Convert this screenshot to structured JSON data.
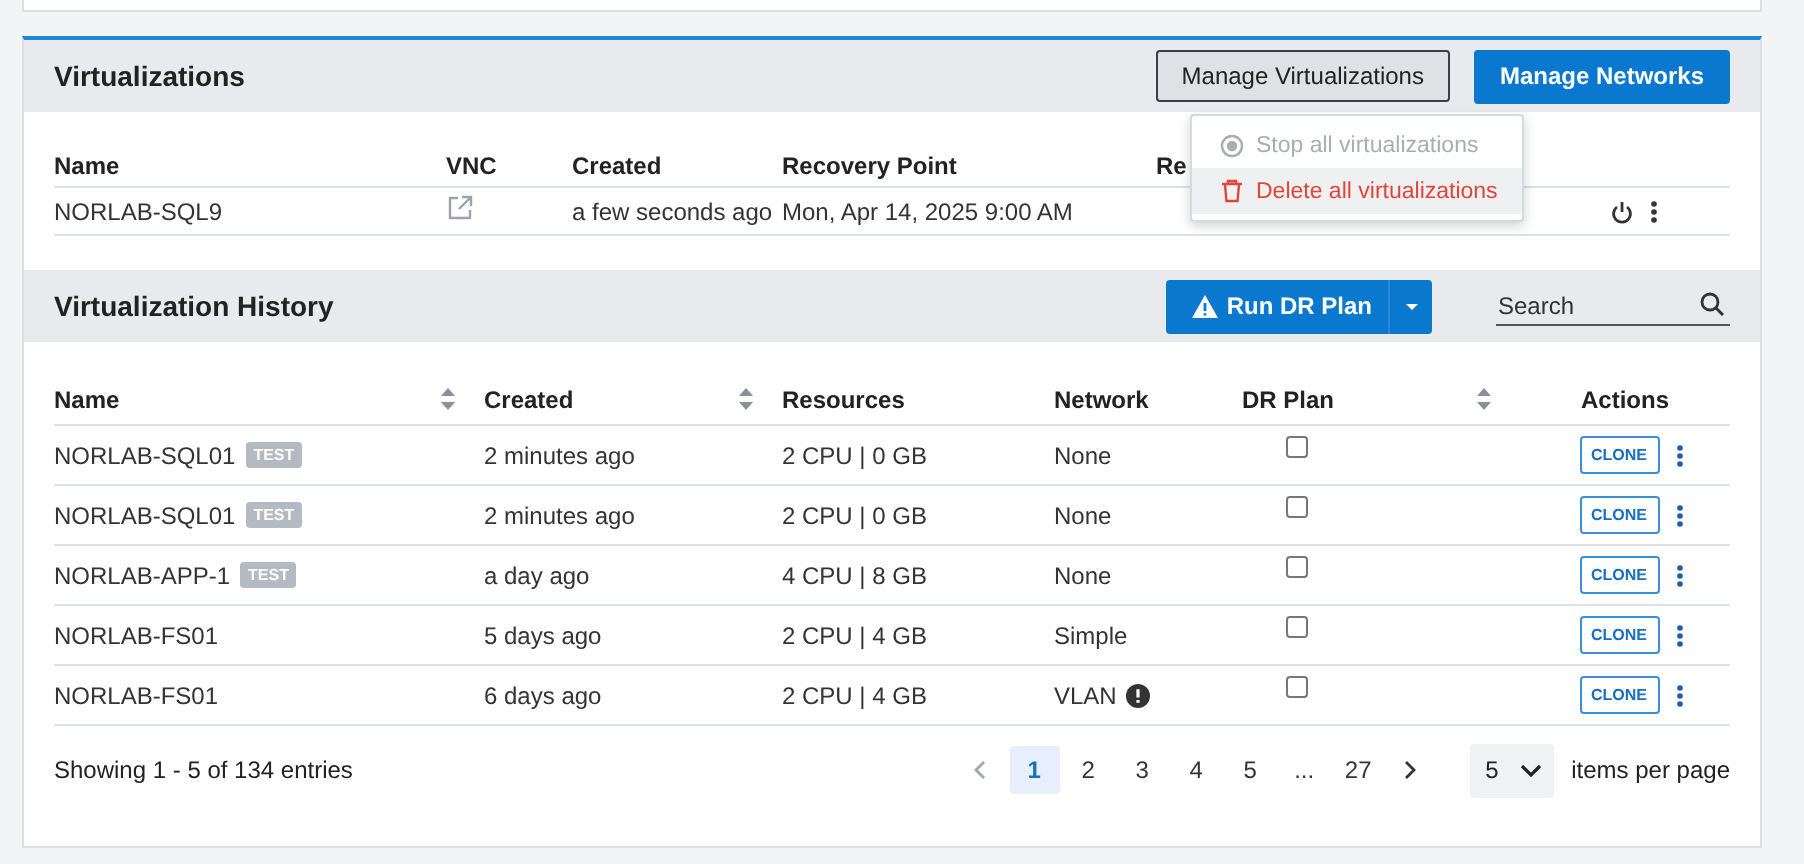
{
  "virtualizations": {
    "title": "Virtualizations",
    "buttons": [
      {
        "label": "Manage Virtualizations",
        "kind": "secondary",
        "pressed": true
      },
      {
        "label": "Manage Networks",
        "kind": "primary",
        "pressed": false
      }
    ],
    "menu": {
      "items": [
        {
          "label": "Stop all virtualizations",
          "kind": "stop",
          "disabled": true,
          "hovered": false,
          "danger": false
        },
        {
          "label": "Delete all virtualizations",
          "kind": "delete",
          "disabled": false,
          "hovered": true,
          "danger": true
        }
      ]
    },
    "table": {
      "columns": [
        "Name",
        "VNC",
        "Created",
        "Recovery Point",
        "Re"
      ],
      "rows": [
        {
          "name": "NORLAB-SQL9",
          "created": "a few seconds ago",
          "recovery_point": "Mon, Apr 14, 2025 9:00 AM"
        }
      ]
    }
  },
  "history": {
    "title": "Virtualization History",
    "run_button": {
      "label": "Run DR Plan"
    },
    "search": {
      "placeholder": "Search"
    },
    "columns": [
      {
        "label": "Name",
        "sortable": true
      },
      {
        "label": "Created",
        "sortable": true
      },
      {
        "label": "Resources",
        "sortable": false
      },
      {
        "label": "Network",
        "sortable": false
      },
      {
        "label": "DR Plan",
        "sortable": true
      },
      {
        "label": "Actions",
        "sortable": false
      }
    ],
    "rows": [
      {
        "name": "NORLAB-SQL01",
        "tag": "TEST",
        "created": "2 minutes ago",
        "resources": "2 CPU | 0 GB",
        "network": "None",
        "alert": false,
        "dr_plan": false,
        "action": "CLONE"
      },
      {
        "name": "NORLAB-SQL01",
        "tag": "TEST",
        "created": "2 minutes ago",
        "resources": "2 CPU | 0 GB",
        "network": "None",
        "alert": false,
        "dr_plan": false,
        "action": "CLONE"
      },
      {
        "name": "NORLAB-APP-1",
        "tag": "TEST",
        "created": "a day ago",
        "resources": "4 CPU | 8 GB",
        "network": "None",
        "alert": false,
        "dr_plan": false,
        "action": "CLONE"
      },
      {
        "name": "NORLAB-FS01",
        "created": "5 days ago",
        "resources": "2 CPU | 4 GB",
        "network": "Simple",
        "alert": false,
        "dr_plan": false,
        "action": "CLONE"
      },
      {
        "name": "NORLAB-FS01",
        "created": "6 days ago",
        "resources": "2 CPU | 4 GB",
        "network": "VLAN",
        "alert": true,
        "dr_plan": false,
        "action": "CLONE"
      }
    ],
    "footer": {
      "summary": "Showing 1 - 5 of 134 entries",
      "pages": [
        {
          "label": "1",
          "selected": true
        },
        {
          "label": "2",
          "selected": false
        },
        {
          "label": "3",
          "selected": false
        },
        {
          "label": "4",
          "selected": false
        },
        {
          "label": "5",
          "selected": false
        },
        {
          "label": "...",
          "selected": false
        },
        {
          "label": "27",
          "selected": false
        }
      ],
      "page_size": "5",
      "per_page_label": "items per page"
    }
  }
}
